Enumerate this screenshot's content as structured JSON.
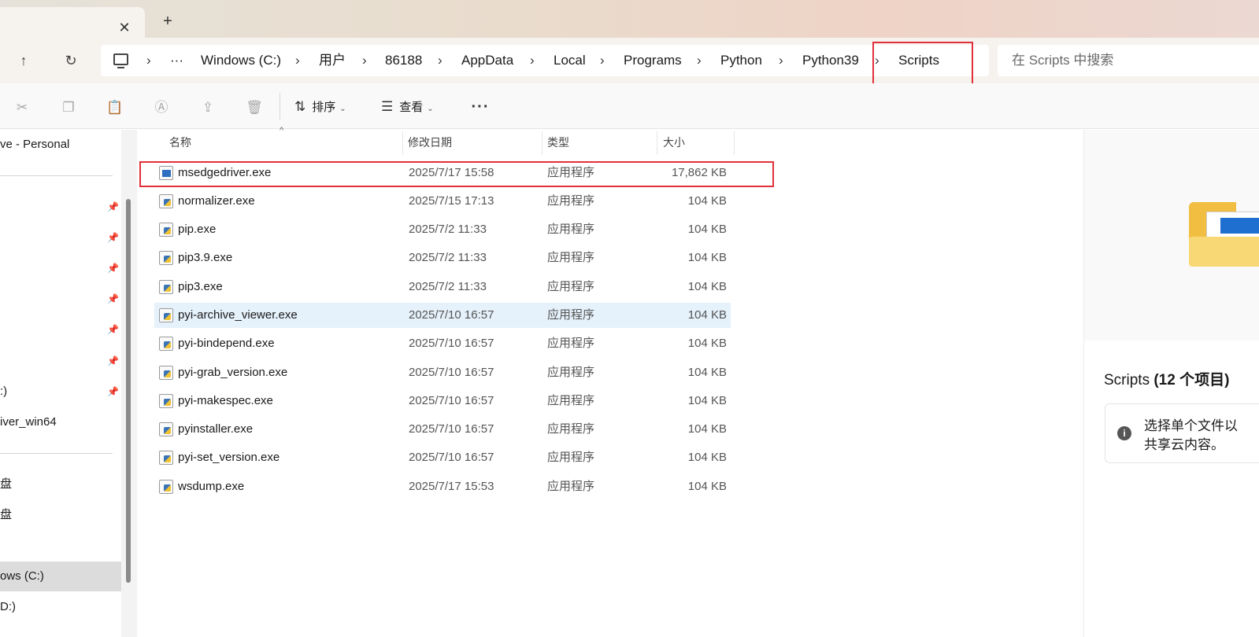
{
  "tabs": {
    "close_glyph": "✕",
    "new_tab_glyph": "+"
  },
  "nav": {
    "up_glyph": "↑",
    "refresh_glyph": "↻"
  },
  "breadcrumb": {
    "ellipsis": "···",
    "items": [
      "Windows (C:)",
      "用户",
      "86188",
      "AppData",
      "Local",
      "Programs",
      "Python",
      "Python39",
      "Scripts"
    ],
    "separator": "›"
  },
  "search": {
    "placeholder": "在 Scripts 中搜索"
  },
  "toolbar": {
    "cut_icon": "cut-icon",
    "sort_label": "排序",
    "view_label": "查看",
    "more_label": "···"
  },
  "sidebar": {
    "items": [
      {
        "label": "ve - Personal"
      },
      {
        "label": ":)"
      },
      {
        "label": "iver_win64"
      },
      {
        "label": "盘"
      },
      {
        "label": "盘"
      },
      {
        "label": "ows (C:)"
      },
      {
        "label": "D:)"
      }
    ]
  },
  "columns": {
    "name": "名称",
    "date": "修改日期",
    "type": "类型",
    "size": "大小"
  },
  "files": [
    {
      "name": "msedgedriver.exe",
      "date": "2025/7/17 15:58",
      "type": "应用程序",
      "size": "17,862 KB",
      "icon": "edge"
    },
    {
      "name": "normalizer.exe",
      "date": "2025/7/15 17:13",
      "type": "应用程序",
      "size": "104 KB",
      "icon": "python"
    },
    {
      "name": "pip.exe",
      "date": "2025/7/2 11:33",
      "type": "应用程序",
      "size": "104 KB",
      "icon": "python"
    },
    {
      "name": "pip3.9.exe",
      "date": "2025/7/2 11:33",
      "type": "应用程序",
      "size": "104 KB",
      "icon": "python"
    },
    {
      "name": "pip3.exe",
      "date": "2025/7/2 11:33",
      "type": "应用程序",
      "size": "104 KB",
      "icon": "python"
    },
    {
      "name": "pyi-archive_viewer.exe",
      "date": "2025/7/10 16:57",
      "type": "应用程序",
      "size": "104 KB",
      "icon": "python"
    },
    {
      "name": "pyi-bindepend.exe",
      "date": "2025/7/10 16:57",
      "type": "应用程序",
      "size": "104 KB",
      "icon": "python"
    },
    {
      "name": "pyi-grab_version.exe",
      "date": "2025/7/10 16:57",
      "type": "应用程序",
      "size": "104 KB",
      "icon": "python"
    },
    {
      "name": "pyi-makespec.exe",
      "date": "2025/7/10 16:57",
      "type": "应用程序",
      "size": "104 KB",
      "icon": "python"
    },
    {
      "name": "pyinstaller.exe",
      "date": "2025/7/10 16:57",
      "type": "应用程序",
      "size": "104 KB",
      "icon": "python"
    },
    {
      "name": "pyi-set_version.exe",
      "date": "2025/7/10 16:57",
      "type": "应用程序",
      "size": "104 KB",
      "icon": "python"
    },
    {
      "name": "wsdump.exe",
      "date": "2025/7/17 15:53",
      "type": "应用程序",
      "size": "104 KB",
      "icon": "python"
    }
  ],
  "details": {
    "title_name": "Scripts",
    "title_count": "(12 个项目)",
    "info_line1": "选择单个文件以",
    "info_line2": "共享云内容。"
  },
  "colors": {
    "highlight": "#e0303a",
    "hover_row": "#e5f1fb",
    "selected_sidebar": "#dcdcdc"
  }
}
